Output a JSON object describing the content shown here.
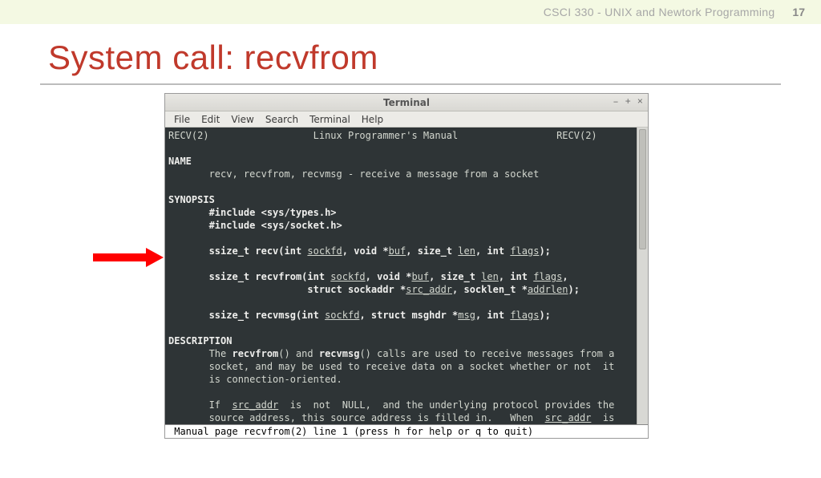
{
  "header": {
    "course": "CSCI 330 - UNIX and Newtork Programming",
    "page": "17"
  },
  "slide": {
    "title": "System call: recvfrom"
  },
  "terminal": {
    "window_title": "Terminal",
    "controls": {
      "min": "–",
      "max": "+",
      "close": "×"
    },
    "menu": [
      "File",
      "Edit",
      "View",
      "Search",
      "Terminal",
      "Help"
    ],
    "header_left": "RECV(2)",
    "header_center": "Linux Programmer's Manual",
    "header_right": "RECV(2)",
    "section_name": "NAME",
    "name_line": "       recv, recvfrom, recvmsg - receive a message from a socket",
    "section_syn": "SYNOPSIS",
    "inc1_pre": "       ",
    "inc1_b": "#include <sys/types.h>",
    "inc2_pre": "       ",
    "inc2_b": "#include <sys/socket.h>",
    "recv_pre": "       ",
    "recv_ret": "ssize_t recv(int ",
    "recv_sockfd": "sockfd",
    "recv_mid1": ", void *",
    "recv_buf": "buf",
    "recv_mid2": ", size_t ",
    "recv_len": "len",
    "recv_mid3": ", int ",
    "recv_flags": "flags",
    "recv_end": ");",
    "rf_pre": "       ",
    "rf_ret": "ssize_t recvfrom(int ",
    "rf_sockfd": "sockfd",
    "rf_m1": ", void *",
    "rf_buf": "buf",
    "rf_m2": ", size_t ",
    "rf_len": "len",
    "rf_m3": ", int ",
    "rf_flags": "flags",
    "rf_m4": ",",
    "rf2_pre": "                        ",
    "rf2_a": "struct sockaddr *",
    "rf2_src": "src_addr",
    "rf2_m": ", socklen_t *",
    "rf2_addrlen": "addrlen",
    "rf2_end": ");",
    "rm_pre": "       ",
    "rm_ret": "ssize_t recvmsg(int ",
    "rm_sockfd": "sockfd",
    "rm_m1": ", struct msghdr *",
    "rm_msg": "msg",
    "rm_m2": ", int ",
    "rm_flags": "flags",
    "rm_end": ");",
    "section_desc": "DESCRIPTION",
    "d1_pre": "       The ",
    "d1_rf": "recvfrom",
    "d1_mid": "() and ",
    "d1_rm": "recvmsg",
    "d1_tail": "() calls are used to receive messages from a",
    "d2": "       socket, and may be used to receive data on a socket whether or not  it",
    "d3": "       is connection-oriented.",
    "d4_pre": "       If  ",
    "d4_src": "src_addr",
    "d4_tail": "  is  not  NULL,  and the underlying protocol provides the",
    "d5_pre": "       source address, this source address is filled in.   When  ",
    "d5_src": "src_addr",
    "d5_tail": "  is",
    "status": " Manual page recvfrom(2) line 1 (press h for help or q to quit)"
  }
}
